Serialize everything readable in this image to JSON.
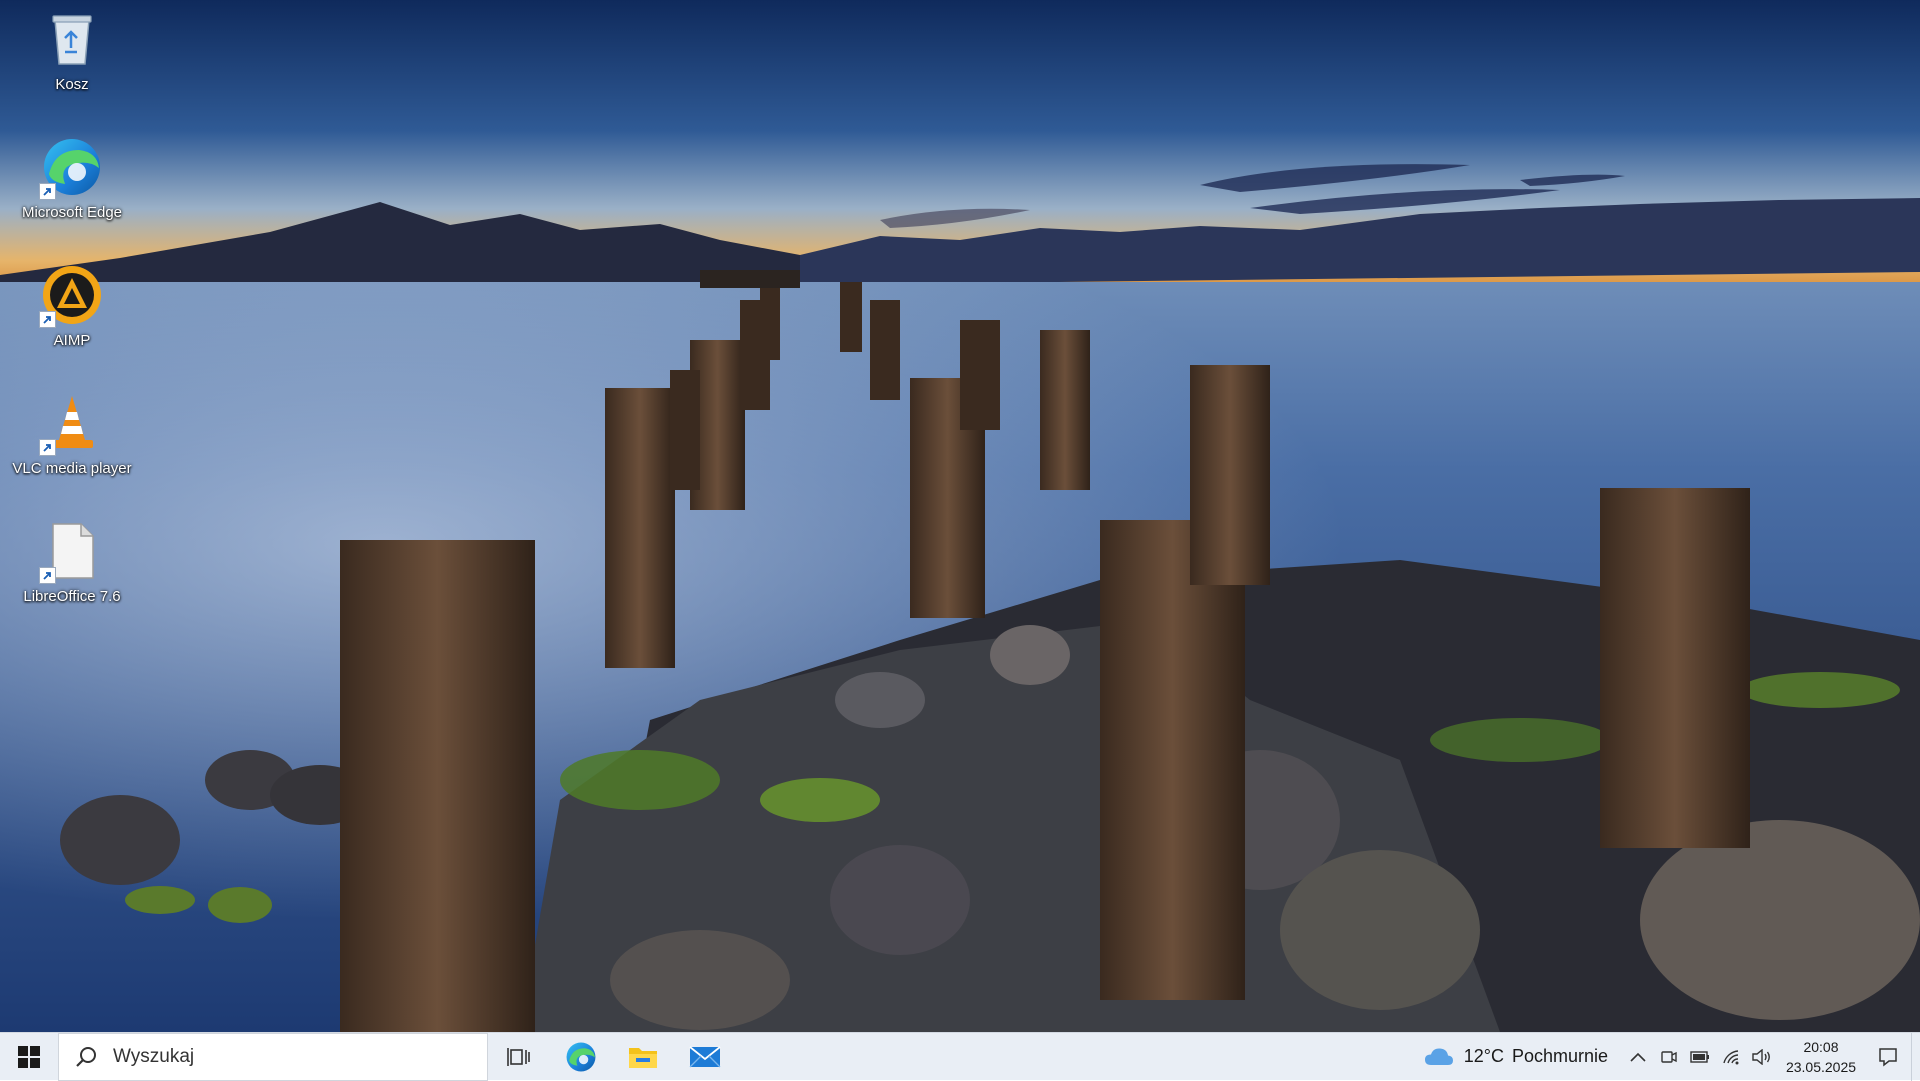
{
  "desktop": {
    "wallpaper": "lakeshore pier posts at dusk",
    "icons": [
      {
        "label": "Kosz",
        "icon": "recycle-bin-icon"
      },
      {
        "label": "Microsoft Edge",
        "icon": "edge-icon",
        "shortcut": true
      },
      {
        "label": "AIMP",
        "icon": "aimp-icon",
        "shortcut": true
      },
      {
        "label": "VLC media player",
        "icon": "vlc-icon",
        "shortcut": true
      },
      {
        "label": "LibreOffice 7.6",
        "icon": "document-icon",
        "shortcut": true
      }
    ]
  },
  "taskbar": {
    "search": {
      "placeholder": "Wyszukaj"
    },
    "pinned_apps": [
      {
        "name": "Task View",
        "icon": "task-view-icon"
      },
      {
        "name": "Microsoft Edge",
        "icon": "edge-icon"
      },
      {
        "name": "File Explorer",
        "icon": "folder-icon"
      },
      {
        "name": "Mail",
        "icon": "mail-icon"
      }
    ],
    "weather": {
      "temperature": "12°C",
      "condition": "Pochmurnie",
      "icon": "cloud-icon"
    },
    "tray": [
      "chevron-up-icon",
      "meet-now-icon",
      "battery-icon",
      "wifi-icon",
      "volume-icon"
    ],
    "clock": {
      "time": "20:08",
      "date": "23.05.2025"
    },
    "notifications_icon": "notification-icon"
  },
  "colors": {
    "taskbar_bg": "#e9eef5",
    "sky_top": "#123064",
    "horizon_glow": "#e9a24a",
    "water": "#2f548f"
  }
}
